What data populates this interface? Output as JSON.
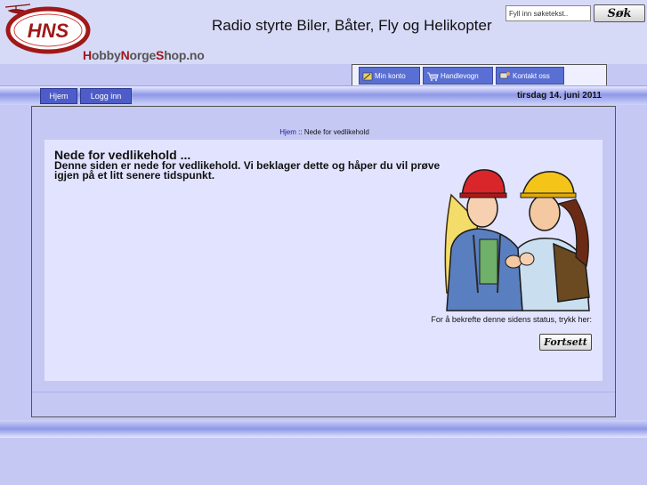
{
  "header": {
    "logo_text": "HNS",
    "site_name_parts": [
      "H",
      "obby",
      "N",
      "orge",
      "S",
      "hop.no"
    ],
    "tagline": "Radio styrte Biler, Båter, Fly og Helikopter"
  },
  "search": {
    "placeholder": "Fyll inn søketekst..",
    "value": "Fyll inn søketekst..",
    "button_label": "Søk"
  },
  "top_nav": {
    "tabs": [
      {
        "label": "Min konto",
        "icon": "account-icon"
      },
      {
        "label": "Handlevogn",
        "icon": "cart-icon"
      },
      {
        "label": "Kontakt oss",
        "icon": "contact-icon"
      }
    ]
  },
  "nav": {
    "home_label": "Hjem",
    "login_label": "Logg inn",
    "date": "tirsdag 14. juni 2011"
  },
  "breadcrumb": {
    "home": "Hjem",
    "separator": "::",
    "current": "Nede for vedlikehold"
  },
  "content": {
    "title": "Nede for vedlikehold ...",
    "message": "Denne siden er nede for vedlikehold. Vi beklager dette og håper du vil prøve igjen på et litt senere tidspunkt.",
    "confirm_text": "For å bekrefte denne sidens status, trykk her:",
    "continue_label": "Fortsett"
  },
  "colors": {
    "page_bg": "#c6c8f4",
    "panel_bg": "#e2e4ff",
    "tab_bg": "#5a6fd3",
    "nav_button_bg": "#4d5cc8",
    "logo_red": "#a01818"
  }
}
